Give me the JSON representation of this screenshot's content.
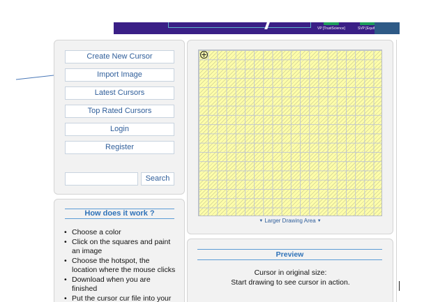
{
  "banner": {
    "caption_left": "VP [TrustScience]",
    "caption_right": "SVP [Equifax]"
  },
  "sidebar": {
    "buttons": [
      {
        "label": "Create New Cursor"
      },
      {
        "label": "Import Image"
      },
      {
        "label": "Latest Cursors"
      },
      {
        "label": "Top Rated Cursors"
      },
      {
        "label": "Login"
      },
      {
        "label": "Register"
      }
    ],
    "search": {
      "placeholder": "",
      "button_label": "Search"
    }
  },
  "how": {
    "title": "How does it work ?",
    "steps": [
      "Choose a color",
      "Click on the squares and paint an image",
      "Choose the hotspot, the location where the mouse clicks",
      "Download when you are finished",
      "Put the cursor cur file into your"
    ]
  },
  "editor": {
    "larger_area_label": "Larger Drawing Area"
  },
  "preview": {
    "title": "Preview",
    "line1": "Cursor in original size:",
    "line2": "Start drawing to see cursor in action."
  },
  "colors": {
    "grid_fill": "#ffffaa",
    "link": "#2f5e9a",
    "heading": "#2f72b8",
    "arrow": "#4a78b8",
    "banner": "#3a1f86"
  },
  "icons": {
    "hotspot": "crosshair-icon",
    "expand": "triangle-down-icon",
    "annotation": "arrow-icon"
  }
}
